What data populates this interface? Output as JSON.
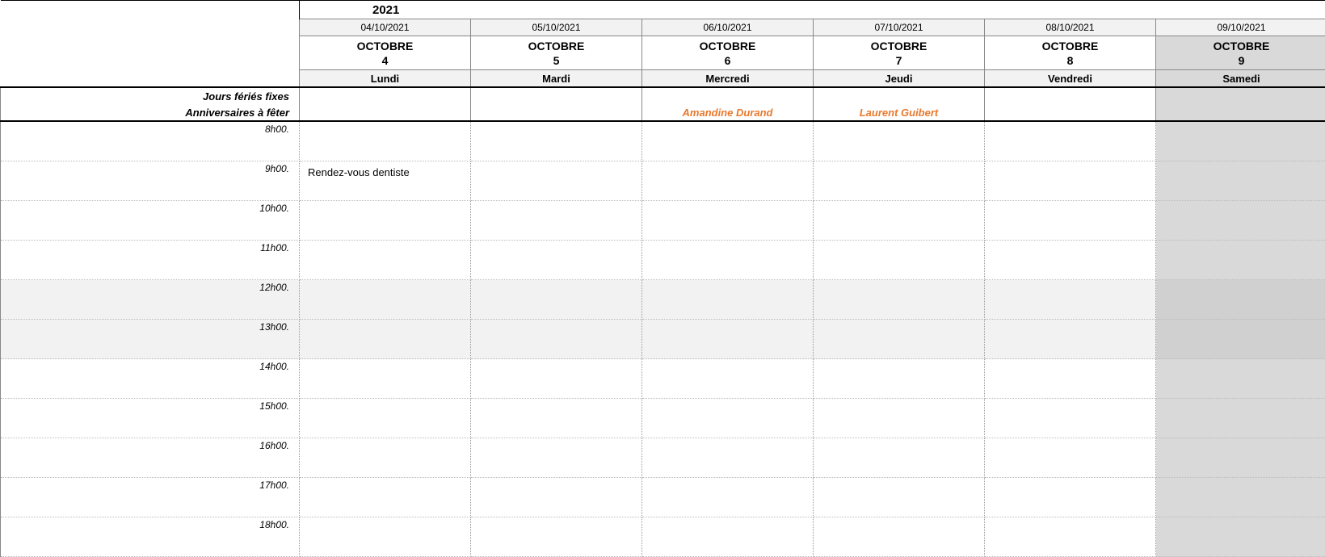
{
  "year": "2021",
  "rows": {
    "fixed_holidays_label": "Jours fériés fixes",
    "birthdays_label": "Anniversaires à fêter"
  },
  "days": [
    {
      "date": "04/10/2021",
      "month": "OCTOBRE",
      "num": "4",
      "dow": "Lundi",
      "weekend": false,
      "birthday": ""
    },
    {
      "date": "05/10/2021",
      "month": "OCTOBRE",
      "num": "5",
      "dow": "Mardi",
      "weekend": false,
      "birthday": ""
    },
    {
      "date": "06/10/2021",
      "month": "OCTOBRE",
      "num": "6",
      "dow": "Mercredi",
      "weekend": false,
      "birthday": "Amandine Durand"
    },
    {
      "date": "07/10/2021",
      "month": "OCTOBRE",
      "num": "7",
      "dow": "Jeudi",
      "weekend": false,
      "birthday": "Laurent Guibert"
    },
    {
      "date": "08/10/2021",
      "month": "OCTOBRE",
      "num": "8",
      "dow": "Vendredi",
      "weekend": false,
      "birthday": ""
    },
    {
      "date": "09/10/2021",
      "month": "OCTOBRE",
      "num": "9",
      "dow": "Samedi",
      "weekend": true,
      "birthday": ""
    }
  ],
  "hours": [
    "8h00.",
    "9h00.",
    "10h00.",
    "11h00.",
    "12h00.",
    "13h00.",
    "14h00.",
    "15h00.",
    "16h00.",
    "17h00.",
    "18h00."
  ],
  "lunch_hours": [
    "12h00.",
    "13h00."
  ],
  "events": {
    "9h00._0": "Rendez-vous dentiste"
  }
}
